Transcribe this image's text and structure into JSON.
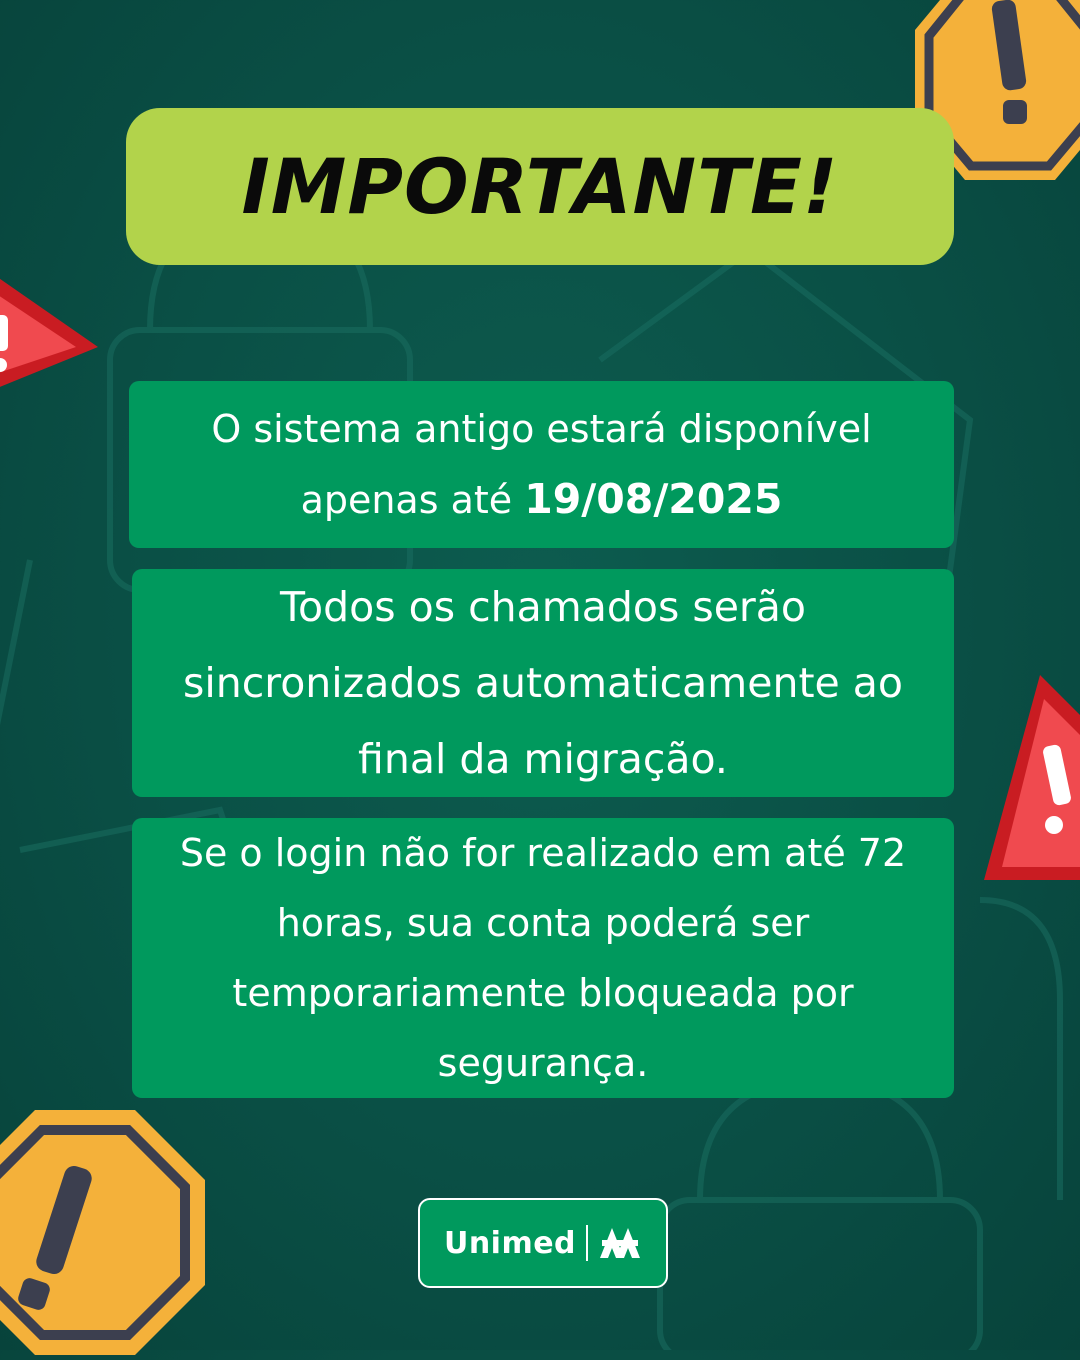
{
  "title": "IMPORTANTE!",
  "cards": [
    {
      "lines": [
        "O sistema antigo estará disponível"
      ],
      "prefix": "apenas até ",
      "date": "19/08/2025"
    },
    {
      "lines": [
        "Todos os chamados serão",
        "sincronizados automaticamente ao",
        "final da migração."
      ]
    },
    {
      "lines": [
        "Se o login não for realizado em até 72",
        "horas, sua conta poderá ser",
        "temporariamente bloqueada por",
        "segurança."
      ]
    }
  ],
  "logo": {
    "brand": "Unimed"
  },
  "icons": [
    "warning-octagon-icon",
    "warning-triangle-icon",
    "padlock-icon"
  ],
  "colors": {
    "background": "#0a4f45",
    "title_box": "#b2d34b",
    "card": "#00995d",
    "warning_red": "#e8262b",
    "warning_yellow": "#f6b93b"
  }
}
